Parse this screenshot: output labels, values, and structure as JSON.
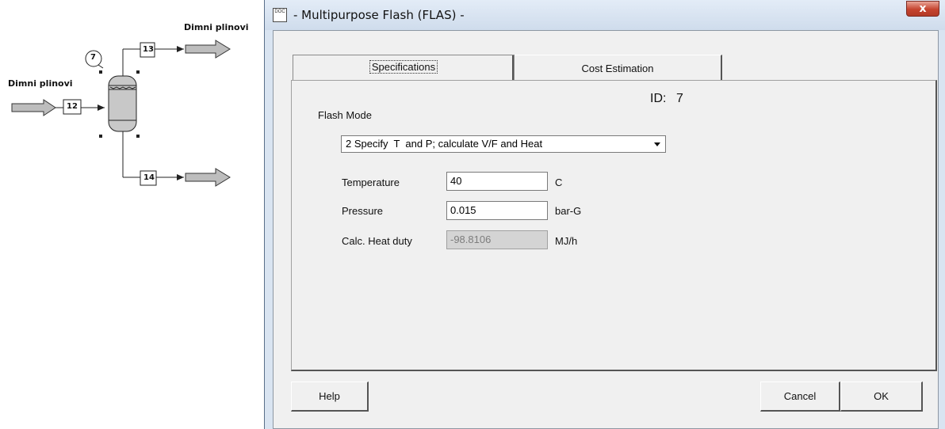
{
  "flowsheet": {
    "stream_label_out": "Dimni plinovi",
    "stream_label_in": "Dimni plinovi",
    "unit_id": "7",
    "stream_in": "12",
    "stream_top": "13",
    "stream_bottom": "14"
  },
  "dialog": {
    "title": "- Multipurpose Flash (FLAS) -",
    "title_icon": "doc-icon",
    "close_label": "x",
    "tabs": [
      {
        "label": "Specifications",
        "selected": true
      },
      {
        "label": "Cost Estimation",
        "selected": false
      }
    ],
    "id_label": "ID:",
    "id_value": "7",
    "flash_mode_label": "Flash Mode",
    "flash_mode_value": "2 Specify  T  and P; calculate V/F and Heat",
    "fields": [
      {
        "label": "Temperature",
        "value": "40",
        "unit": "C"
      },
      {
        "label": "Pressure",
        "value": "0.015",
        "unit": "bar-G"
      },
      {
        "label": "Calc. Heat duty",
        "value": "-98.8106",
        "unit": "MJ/h"
      }
    ],
    "buttons": {
      "help": "Help",
      "cancel": "Cancel",
      "ok": "OK"
    }
  }
}
